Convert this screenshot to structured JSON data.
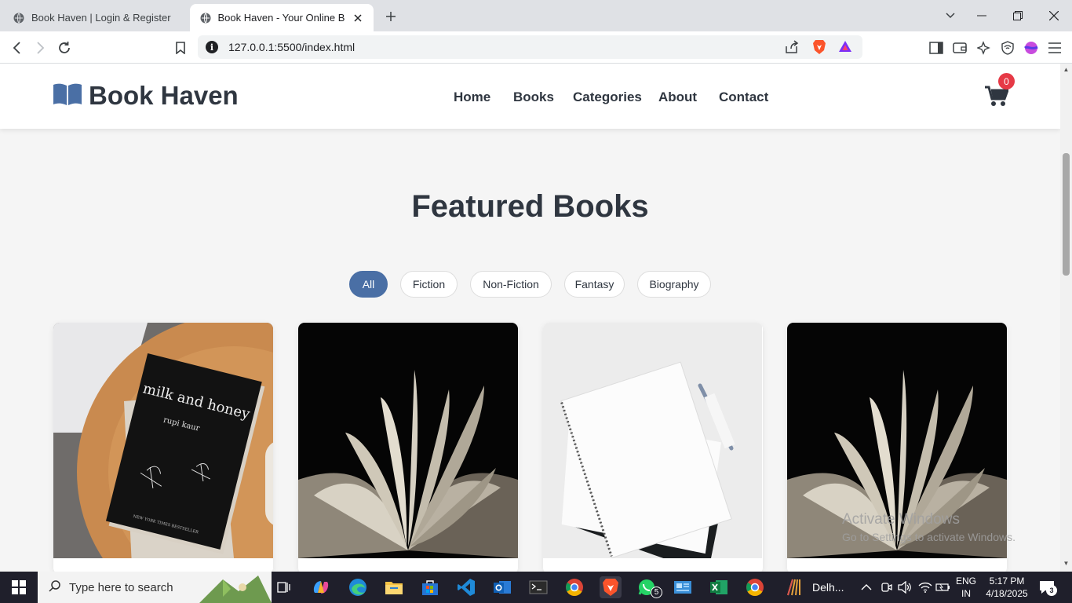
{
  "browser": {
    "tabs": [
      {
        "title": "Book Haven | Login & Register"
      },
      {
        "title": "Book Haven - Your Online Book Store"
      }
    ],
    "url": "127.0.0.1:5500/index.html"
  },
  "site": {
    "brand": "Book Haven",
    "nav": [
      "Home",
      "Books",
      "Categories",
      "About",
      "Contact"
    ],
    "cart_count": "0",
    "section_title": "Featured Books",
    "filters": [
      "All",
      "Fiction",
      "Non-Fiction",
      "Fantasy",
      "Biography"
    ],
    "active_filter": "All",
    "cover1": {
      "title": "milk and honey",
      "author": "rupi kaur",
      "tagline": "NEW YORK TIMES BESTSELLER"
    },
    "accent_color": "#4a6fa5"
  },
  "watermark": {
    "line1": "Activate Windows",
    "line2": "Go to Settings to activate Windows."
  },
  "taskbar": {
    "search_placeholder": "Type here to search",
    "whatsapp_badge": "5",
    "app_label": "Delh...",
    "lang1": "ENG",
    "lang2": "IN",
    "time": "5:17 PM",
    "date": "4/18/2025",
    "notifications": "3"
  }
}
